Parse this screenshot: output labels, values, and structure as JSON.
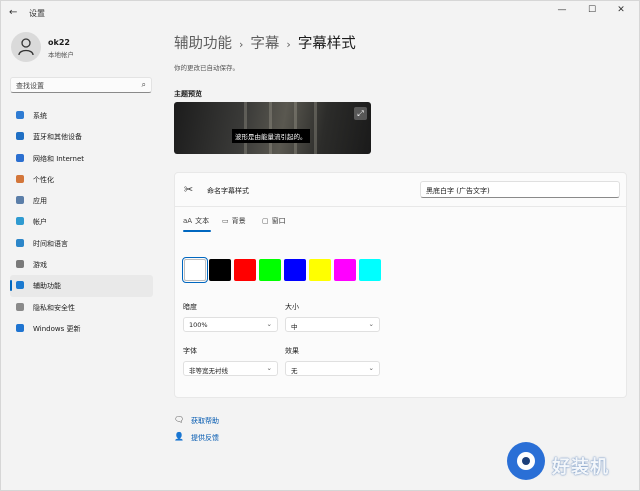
{
  "window": {
    "title": "设置",
    "back": "←",
    "minimize": "—",
    "maximize": "☐",
    "close": "✕"
  },
  "profile": {
    "name": "ok22",
    "subtitle": "本地帐户"
  },
  "search": {
    "placeholder": "查找设置",
    "icon": "search-icon"
  },
  "sidebar": {
    "items": [
      {
        "label": "系统",
        "icon": "monitor-icon",
        "color": "#2f7cd3"
      },
      {
        "label": "蓝牙和其他设备",
        "icon": "bluetooth-icon",
        "color": "#1f6fc4"
      },
      {
        "label": "网络和 Internet",
        "icon": "network-icon",
        "color": "#2b6fd0"
      },
      {
        "label": "个性化",
        "icon": "brush-icon",
        "color": "#d3763a"
      },
      {
        "label": "应用",
        "icon": "apps-icon",
        "color": "#5b7ea8"
      },
      {
        "label": "帐户",
        "icon": "person-icon",
        "color": "#2f9bd1"
      },
      {
        "label": "时间和语言",
        "icon": "globe-icon",
        "color": "#2c86c9"
      },
      {
        "label": "游戏",
        "icon": "gamepad-icon",
        "color": "#7a7a7a"
      },
      {
        "label": "辅助功能",
        "icon": "accessibility-icon",
        "color": "#1b7ad0",
        "active": true
      },
      {
        "label": "隐私和安全性",
        "icon": "shield-icon",
        "color": "#8a8a8a"
      },
      {
        "label": "Windows 更新",
        "icon": "update-icon",
        "color": "#1f74d1"
      }
    ]
  },
  "breadcrumb": {
    "part1": "辅助功能",
    "part2": "字幕",
    "part3": "字幕样式",
    "separator": "›"
  },
  "autosave_note": "你的更改已自动保存。",
  "preview": {
    "title": "主题预览",
    "caption": "波形是由能量流引起的。"
  },
  "style_name": {
    "label": "命名字幕样式",
    "value": "黑底白字 (广告文字)"
  },
  "tabs": [
    {
      "label": "文本",
      "icon": "aA"
    },
    {
      "label": "背景",
      "icon": "▭"
    },
    {
      "label": "窗口",
      "icon": "▢"
    }
  ],
  "colors": [
    "#ffffff",
    "#000000",
    "#ff0000",
    "#00ff00",
    "#0000ff",
    "#ffff00",
    "#ff00ff",
    "#00ffff"
  ],
  "selected_color_index": 0,
  "fields": {
    "opacity": {
      "label": "暗度",
      "value": "100%"
    },
    "size": {
      "label": "大小",
      "value": "中"
    },
    "font": {
      "label": "字体",
      "value": "非等宽无衬线"
    },
    "effect": {
      "label": "效果",
      "value": "无"
    }
  },
  "links": {
    "help": "获取帮助",
    "feedback": "提供反馈"
  },
  "watermark": {
    "text": "好装机"
  }
}
